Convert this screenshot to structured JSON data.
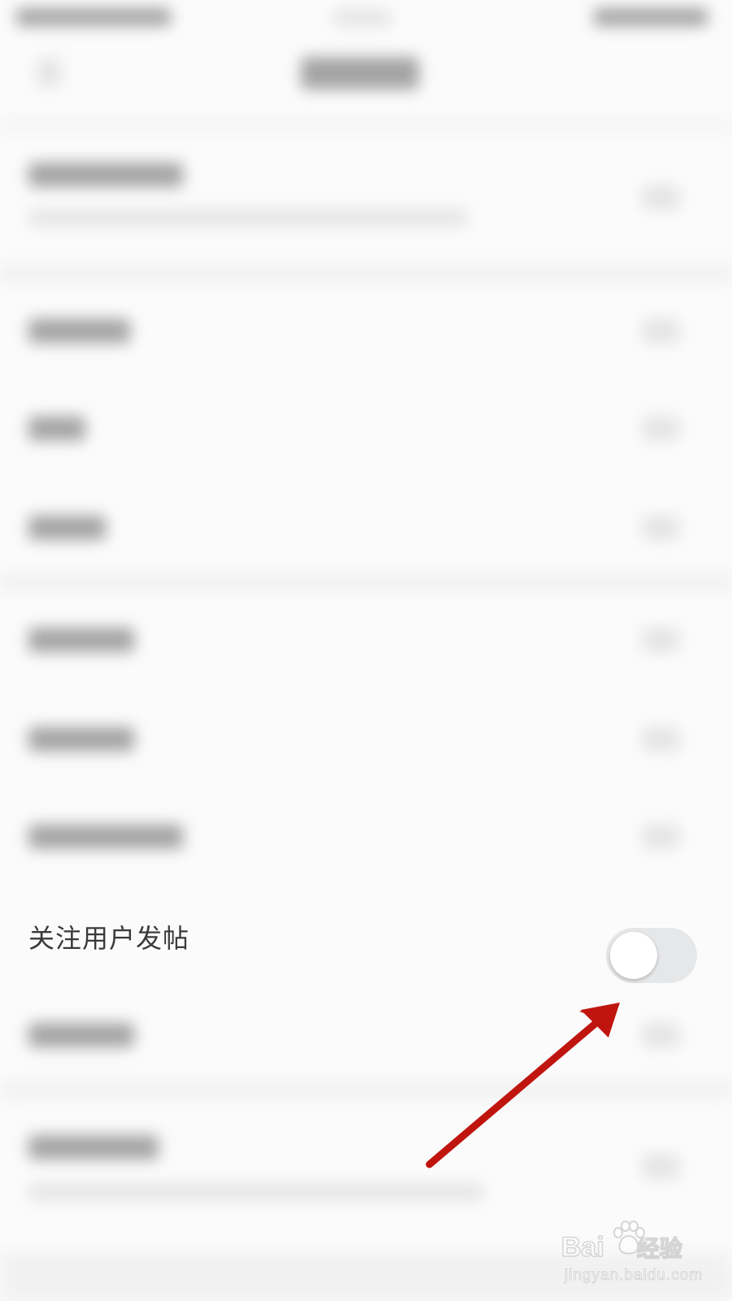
{
  "setting": {
    "label": "关注用户发帖",
    "toggle_on": false
  },
  "watermark": {
    "brand": "Bai",
    "brand_cn": "经验",
    "url": "jingyan.baidu.com"
  },
  "colors": {
    "background": "#fbfbfb",
    "label_text": "#3a3a3a",
    "toggle_off_track": "#e6e7e9",
    "toggle_knob": "#ffffff",
    "annotation_arrow": "#c0150f"
  },
  "icons": {
    "annotation": "red-arrow-icon",
    "watermark_logo": "baidu-paw-icon"
  }
}
